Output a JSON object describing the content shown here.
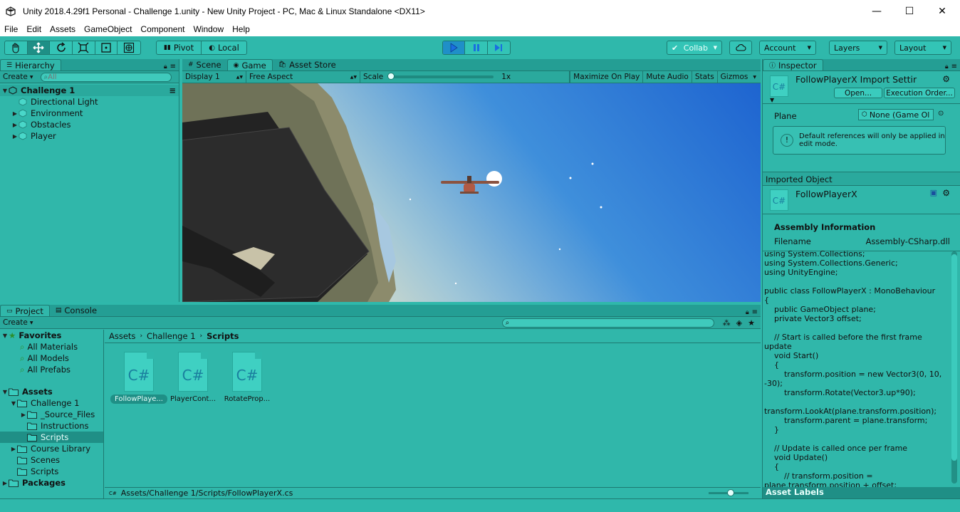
{
  "window": {
    "title": "Unity 2018.4.29f1 Personal - Challenge 1.unity - New Unity Project - PC, Mac & Linux Standalone <DX11>",
    "minimize": "—",
    "maximize": "☐",
    "close": "✕"
  },
  "menu": [
    "File",
    "Edit",
    "Assets",
    "GameObject",
    "Component",
    "Window",
    "Help"
  ],
  "toolbar": {
    "pivot": "Pivot",
    "local": "Local",
    "collab": "Collab",
    "account": "Account",
    "layers": "Layers",
    "layout": "Layout"
  },
  "hierarchy": {
    "tab": "Hierarchy",
    "create": "Create",
    "search_placeholder": "All",
    "scene": "Challenge 1",
    "items": [
      "Directional Light",
      "Environment",
      "Obstacles",
      "Player"
    ]
  },
  "scene_tabs": {
    "scene": "Scene",
    "game": "Game",
    "asset_store": "Asset Store"
  },
  "game_bar": {
    "display": "Display 1",
    "aspect": "Free Aspect",
    "scale_label": "Scale",
    "scale_value": "1x",
    "scale_level": 0,
    "maximize": "Maximize On Play",
    "mute": "Mute Audio",
    "stats": "Stats",
    "gizmos": "Gizmos"
  },
  "inspector": {
    "tab": "Inspector",
    "header_title": "FollowPlayerX Import Settir",
    "open_button": "Open...",
    "exec_order_button": "Execution Order...",
    "plane_label": "Plane",
    "plane_value": "None (Game Ol",
    "info": "Default references will only be applied in edit mode.",
    "imported_object": "Imported Object",
    "object_name": "FollowPlayerX",
    "assembly_info": "Assembly Information",
    "filename_label": "Filename",
    "filename_value": "Assembly-CSharp.dll",
    "code": "using System.Collections;\nusing System.Collections.Generic;\nusing UnityEngine;\n\npublic class FollowPlayerX : MonoBehaviour\n{\n    public GameObject plane;\n    private Vector3 offset;\n\n    // Start is called before the first frame update\n    void Start()\n    {\n        transform.position = new Vector3(0, 10, -30);\n        transform.Rotate(Vector3.up*90);\n\ntransform.LookAt(plane.transform.position);\n        transform.parent = plane.transform;\n    }\n\n    // Update is called once per frame\n    void Update()\n    {\n        // transform.position =\nplane.transform.position + offset;",
    "asset_labels": "Asset Labels",
    "csharp_icon": "C#"
  },
  "project": {
    "tab_project": "Project",
    "tab_console": "Console",
    "create": "Create",
    "favorites": "Favorites",
    "favorite_items": [
      "All Materials",
      "All Models",
      "All Prefabs"
    ],
    "assets": "Assets",
    "challenge": "Challenge 1",
    "challenge_children": [
      "_Source_Files",
      "Instructions",
      "Scripts"
    ],
    "other_folders": [
      "Course Library",
      "Scenes",
      "Scripts"
    ],
    "packages": "Packages",
    "breadcrumb": [
      "Assets",
      "Challenge 1",
      "Scripts"
    ],
    "files": [
      "FollowPlaye...",
      "PlayerCont...",
      "RotateProp..."
    ],
    "file_icon_text": "C#",
    "status_path": "Assets/Challenge 1/Scripts/FollowPlayerX.cs"
  },
  "colors": {
    "panel": "#30b7aa",
    "tabbar": "#249e94",
    "play_active": "#1f9ad6",
    "sky_top": "#1f6fd6",
    "sky_bottom": "#e9e6c8"
  },
  "icons": [
    "hand-tool-icon",
    "move-tool-icon",
    "rotate-tool-icon",
    "scale-tool-icon",
    "rect-tool-icon",
    "transform-tool-icon",
    "play-icon",
    "pause-icon",
    "step-icon",
    "cloud-icon",
    "lock-icon",
    "menu-icon",
    "gear-icon",
    "info-icon"
  ]
}
